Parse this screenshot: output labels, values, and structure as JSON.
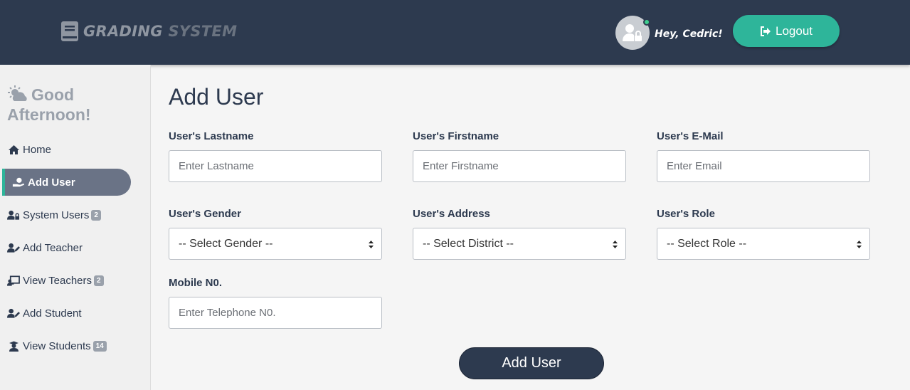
{
  "header": {
    "brand_word1": "GRADING",
    "brand_word2": "SYSTEM",
    "greeting": "Hey, Cedric!",
    "logout_label": "Logout",
    "status_color": "#3ecf8e"
  },
  "sidebar": {
    "greeting": "Good Afternoon!",
    "items": [
      {
        "label": "Home",
        "icon": "home-icon"
      },
      {
        "label": "Add User",
        "icon": "hand-user-icon",
        "active": true
      },
      {
        "label": "System Users",
        "icon": "user-lock-icon",
        "badge": "2"
      },
      {
        "label": "Add Teacher",
        "icon": "user-edit-icon"
      },
      {
        "label": "View Teachers",
        "icon": "chalkboard-teacher-icon",
        "badge": "2"
      },
      {
        "label": "Add Student",
        "icon": "user-edit-icon"
      },
      {
        "label": "View Students",
        "icon": "graduate-icon",
        "badge": "14"
      }
    ]
  },
  "form": {
    "title": "Add User",
    "lastname": {
      "label": "User's Lastname",
      "placeholder": "Enter Lastname"
    },
    "firstname": {
      "label": "User's Firstname",
      "placeholder": "Enter Firstname"
    },
    "email": {
      "label": "User's E-Mail",
      "placeholder": "Enter Email"
    },
    "gender": {
      "label": "User's Gender",
      "selected": "-- Select Gender --"
    },
    "address": {
      "label": "User's Address",
      "selected": "-- Select District --"
    },
    "role": {
      "label": "User's Role",
      "selected": "-- Select Role --"
    },
    "mobile": {
      "label": "Mobile N0.",
      "placeholder": "Enter Telephone N0."
    },
    "submit_label": "Add User"
  },
  "colors": {
    "header_bg": "#2d3a4f",
    "accent": "#2eb59a",
    "active_nav": "#6a7386"
  }
}
